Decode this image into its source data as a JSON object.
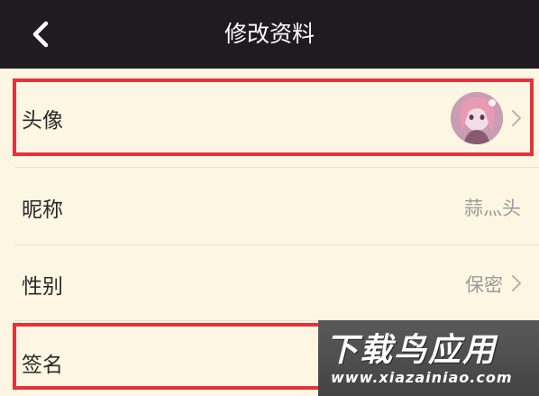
{
  "header": {
    "title": "修改资料",
    "back_icon": "chevron-left-icon"
  },
  "rows": [
    {
      "label": "头像",
      "value": "",
      "icon": "chevron-right-icon"
    },
    {
      "label": "昵称",
      "value": "蒜灬头"
    },
    {
      "label": "性别",
      "value": "保密",
      "icon": "chevron-right-icon"
    },
    {
      "label": "签名",
      "value": ""
    }
  ],
  "watermark": {
    "name": "下载鸟应用",
    "url": "www.xiazainiao.com"
  },
  "colors": {
    "header_bg": "#1f1c20",
    "page_bg": "#fdf6e2",
    "highlight": "#e4333b",
    "value_text": "#9a9a9a"
  }
}
